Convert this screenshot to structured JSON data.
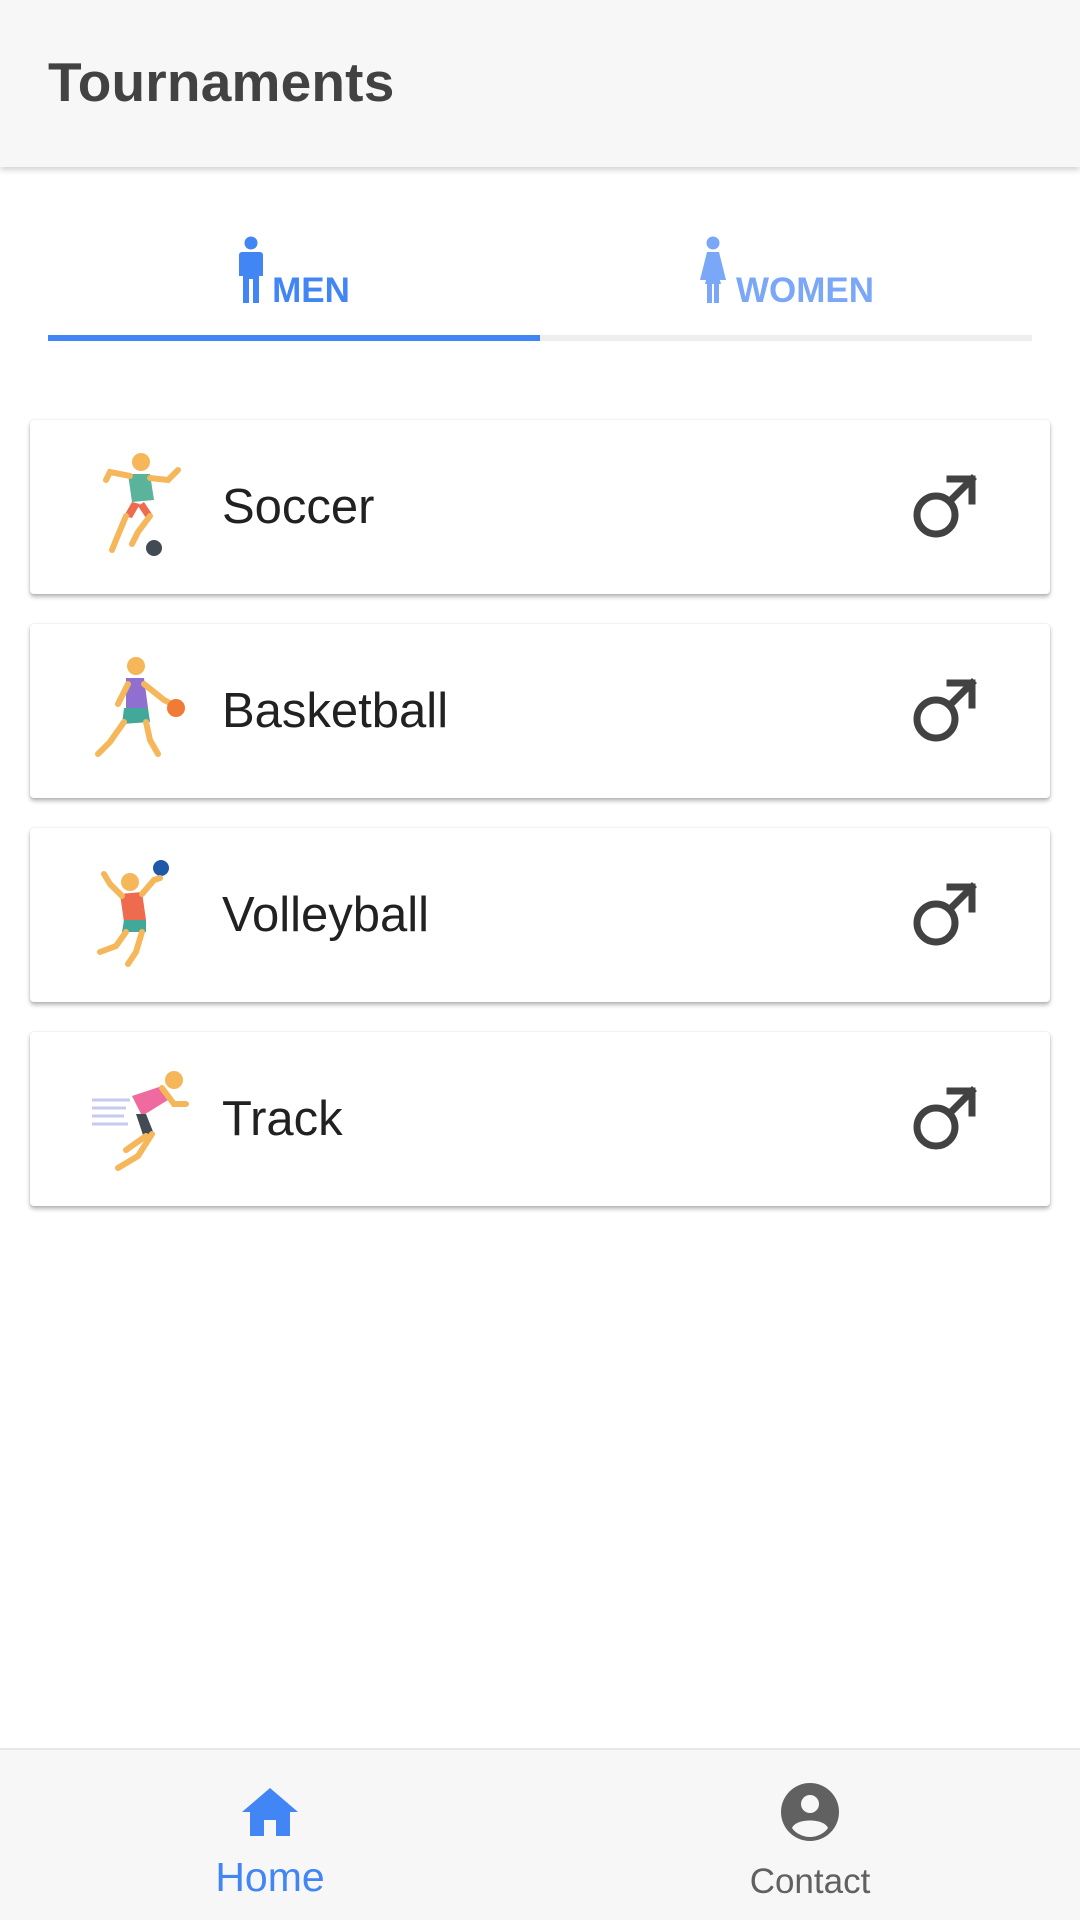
{
  "app_bar": {
    "title": "Tournaments"
  },
  "tabs": [
    {
      "label": "MEN",
      "icon": "man-icon",
      "selected": true,
      "color": "#4285f4"
    },
    {
      "label": "WOMEN",
      "icon": "woman-icon",
      "selected": false,
      "color": "#7aa7f7"
    }
  ],
  "tournaments": [
    {
      "label": "Soccer",
      "icon": "soccer-player-icon",
      "gender_icon": "male-symbol-icon"
    },
    {
      "label": "Basketball",
      "icon": "basketball-player-icon",
      "gender_icon": "male-symbol-icon"
    },
    {
      "label": "Volleyball",
      "icon": "volleyball-player-icon",
      "gender_icon": "male-symbol-icon"
    },
    {
      "label": "Track",
      "icon": "runner-icon",
      "gender_icon": "male-symbol-icon"
    }
  ],
  "bottom_nav": [
    {
      "label": "Home",
      "icon": "home-icon",
      "active": true,
      "color": "#4285f4"
    },
    {
      "label": "Contact",
      "icon": "account-circle-icon",
      "active": false,
      "color": "#616161"
    }
  ],
  "colors": {
    "accent": "#4285f4",
    "accent_light": "#7aa7f7",
    "text_primary": "#212121",
    "icon_gray": "#424242"
  }
}
